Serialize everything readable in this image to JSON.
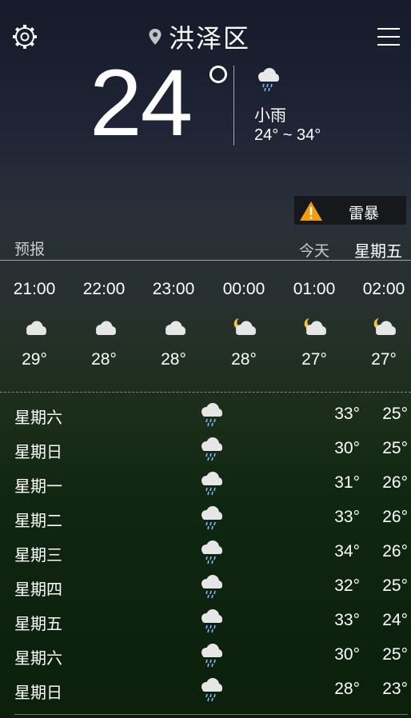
{
  "topbar": {
    "city": "洪泽区"
  },
  "current": {
    "temperature": "24",
    "condition": "小雨",
    "range": "24° ~ 34°"
  },
  "alert": {
    "label": "雷暴",
    "color": "#f39c12"
  },
  "forecast_header": {
    "label": "预报",
    "today": "今天",
    "weekday": "星期五"
  },
  "hourly": [
    {
      "time": "21:00",
      "temp": "29°",
      "icon": "cloudy-icon"
    },
    {
      "time": "22:00",
      "temp": "28°",
      "icon": "cloudy-icon"
    },
    {
      "time": "23:00",
      "temp": "28°",
      "icon": "cloudy-icon"
    },
    {
      "time": "00:00",
      "temp": "28°",
      "icon": "cloudy-night-icon"
    },
    {
      "time": "01:00",
      "temp": "27°",
      "icon": "cloudy-night-icon"
    },
    {
      "time": "02:00",
      "temp": "27°",
      "icon": "cloudy-night-icon"
    }
  ],
  "daily": [
    {
      "day": "星期六",
      "high": "33°",
      "low": "25°",
      "icon": "rain-icon"
    },
    {
      "day": "星期日",
      "high": "30°",
      "low": "25°",
      "icon": "rain-icon"
    },
    {
      "day": "星期一",
      "high": "31°",
      "low": "26°",
      "icon": "rain-icon"
    },
    {
      "day": "星期二",
      "high": "33°",
      "low": "26°",
      "icon": "rain-icon"
    },
    {
      "day": "星期三",
      "high": "34°",
      "low": "26°",
      "icon": "rain-icon"
    },
    {
      "day": "星期四",
      "high": "32°",
      "low": "25°",
      "icon": "rain-icon"
    },
    {
      "day": "星期五",
      "high": "33°",
      "low": "24°",
      "icon": "rain-icon"
    },
    {
      "day": "星期六",
      "high": "30°",
      "low": "25°",
      "icon": "rain-icon"
    },
    {
      "day": "星期日",
      "high": "28°",
      "low": "23°",
      "icon": "rain-icon"
    }
  ]
}
